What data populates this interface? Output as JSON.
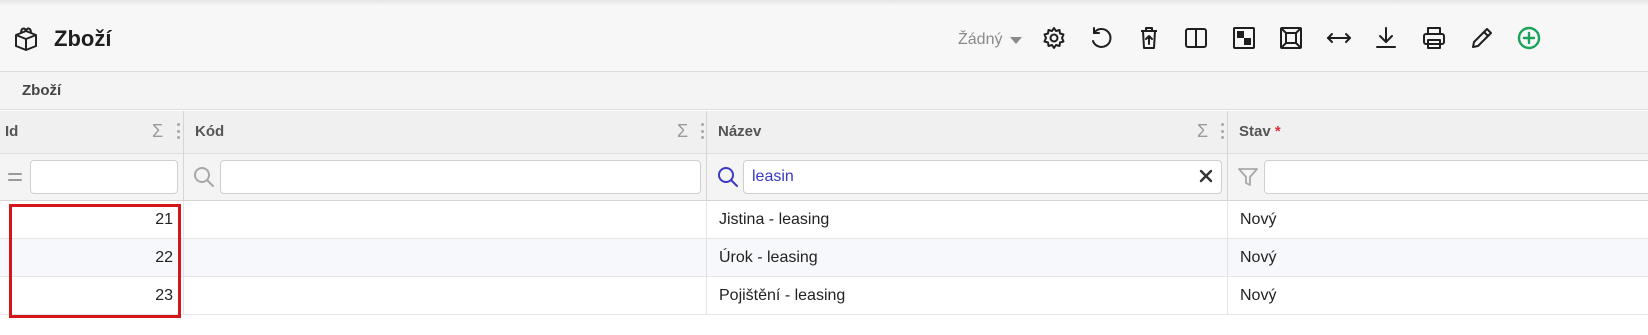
{
  "header": {
    "title": "Zboží",
    "title_icon": "box-icon",
    "view_select": {
      "value": "Žádný"
    },
    "toolbar": [
      {
        "name": "settings-button",
        "icon": "gear-icon"
      },
      {
        "name": "reload-button",
        "icon": "undo-icon"
      },
      {
        "name": "delete-button",
        "icon": "trash-icon"
      },
      {
        "name": "split-view-button",
        "icon": "columns-icon"
      },
      {
        "name": "layout-button",
        "icon": "checker-icon"
      },
      {
        "name": "fit-button",
        "icon": "frame-icon"
      },
      {
        "name": "resize-columns-button",
        "icon": "arrows-horizontal-icon"
      },
      {
        "name": "export-button",
        "icon": "download-icon"
      },
      {
        "name": "print-button",
        "icon": "printer-icon"
      },
      {
        "name": "edit-button",
        "icon": "pencil-icon"
      },
      {
        "name": "add-button",
        "icon": "plus-circle-icon"
      }
    ],
    "accent_color": "#1aa35a"
  },
  "breadcrumb": {
    "label": "Zboží"
  },
  "table": {
    "columns": [
      {
        "label": "Id",
        "required": false,
        "aggregate": true,
        "filter_icon": "equals-icon",
        "filter_value": ""
      },
      {
        "label": "Kód",
        "required": false,
        "aggregate": true,
        "filter_icon": "search-icon",
        "filter_value": ""
      },
      {
        "label": "Název",
        "required": false,
        "aggregate": true,
        "filter_icon": "search-icon",
        "filter_value": "leasin"
      },
      {
        "label": "Stav",
        "required": true,
        "required_mark": "*",
        "aggregate": false,
        "filter_icon": "filter-icon",
        "filter_value": ""
      }
    ],
    "rows": [
      {
        "id": "21",
        "kod": "",
        "nazev": "Jistina - leasing",
        "stav": "Nový"
      },
      {
        "id": "22",
        "kod": "",
        "nazev": "Úrok - leasing",
        "stav": "Nový"
      },
      {
        "id": "23",
        "kod": "",
        "nazev": "Pojištění - leasing",
        "stav": "Nový"
      }
    ],
    "sigma_symbol": "Σ"
  },
  "annotation_color": "#d4151c"
}
